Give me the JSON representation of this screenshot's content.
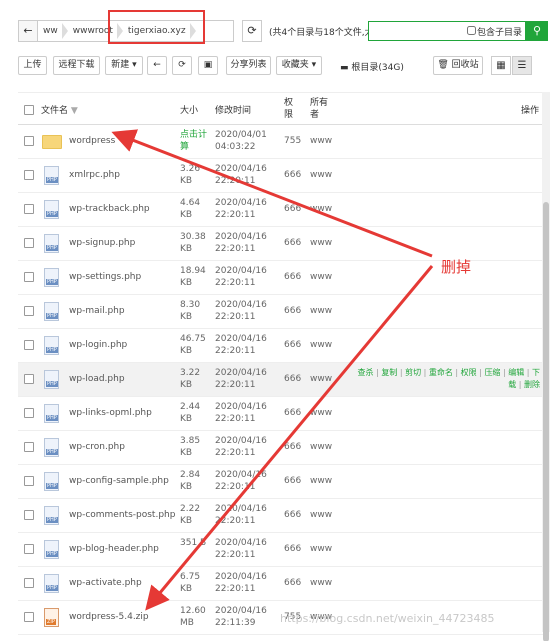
{
  "pathbar": {
    "crumbs": [
      "ww",
      "wwwroot",
      "tigerxiao.xyz"
    ],
    "summary": "(共4个目录与18个文件,大",
    "include_subdir_label": "包含子目录"
  },
  "toolbar": {
    "upload": "上传",
    "remote_download": "远程下载",
    "new": "新建",
    "share_list": "分享列表",
    "favorites": "收藏夹",
    "root_dir": "根目录(34G)",
    "recycle_bin": "回收站"
  },
  "table": {
    "headers": {
      "name": "文件名",
      "size": "大小",
      "modified": "修改时间",
      "perm": "权限",
      "owner": "所有者",
      "ops": "操作"
    },
    "rows": [
      {
        "name": "wordpress",
        "type": "folder",
        "size": "点击计算",
        "date": "2020/04/01",
        "time": "04:03:22",
        "perm": "755",
        "owner": "www"
      },
      {
        "name": "xmlrpc.php",
        "type": "php",
        "size": "3.26 KB",
        "date": "2020/04/16",
        "time": "22:20:11",
        "perm": "666",
        "owner": "www"
      },
      {
        "name": "wp-trackback.php",
        "type": "php",
        "size": "4.64 KB",
        "date": "2020/04/16",
        "time": "22:20:11",
        "perm": "666",
        "owner": "www"
      },
      {
        "name": "wp-signup.php",
        "type": "php",
        "size": "30.38 KB",
        "date": "2020/04/16",
        "time": "22:20:11",
        "perm": "666",
        "owner": "www"
      },
      {
        "name": "wp-settings.php",
        "type": "php",
        "size": "18.94 KB",
        "date": "2020/04/16",
        "time": "22:20:11",
        "perm": "666",
        "owner": "www"
      },
      {
        "name": "wp-mail.php",
        "type": "php",
        "size": "8.30 KB",
        "date": "2020/04/16",
        "time": "22:20:11",
        "perm": "666",
        "owner": "www"
      },
      {
        "name": "wp-login.php",
        "type": "php",
        "size": "46.75 KB",
        "date": "2020/04/16",
        "time": "22:20:11",
        "perm": "666",
        "owner": "www"
      },
      {
        "name": "wp-load.php",
        "type": "php",
        "size": "3.22 KB",
        "date": "2020/04/16",
        "time": "22:20:11",
        "perm": "666",
        "owner": "www"
      },
      {
        "name": "wp-links-opml.php",
        "type": "php",
        "size": "2.44 KB",
        "date": "2020/04/16",
        "time": "22:20:11",
        "perm": "666",
        "owner": "www"
      },
      {
        "name": "wp-cron.php",
        "type": "php",
        "size": "3.85 KB",
        "date": "2020/04/16",
        "time": "22:20:11",
        "perm": "666",
        "owner": "www"
      },
      {
        "name": "wp-config-sample.php",
        "type": "php",
        "size": "2.84 KB",
        "date": "2020/04/16",
        "time": "22:20:11",
        "perm": "666",
        "owner": "www"
      },
      {
        "name": "wp-comments-post.php",
        "type": "php",
        "size": "2.22 KB",
        "date": "2020/04/16",
        "time": "22:20:11",
        "perm": "666",
        "owner": "www"
      },
      {
        "name": "wp-blog-header.php",
        "type": "php",
        "size": "351 B",
        "date": "2020/04/16",
        "time": "22:20:11",
        "perm": "666",
        "owner": "www"
      },
      {
        "name": "wp-activate.php",
        "type": "php",
        "size": "6.75 KB",
        "date": "2020/04/16",
        "time": "22:20:11",
        "perm": "666",
        "owner": "www"
      },
      {
        "name": "wordpress-5.4.zip",
        "type": "zip",
        "size": "12.60 MB",
        "date": "2020/04/16",
        "time": "22:11:39",
        "perm": "755",
        "owner": "www"
      }
    ],
    "row_ops": {
      "line1": [
        "查杀",
        "复制",
        "剪切",
        "重命名",
        "权限",
        "压缩",
        "编辑",
        "下"
      ],
      "line2": [
        "载",
        "删除"
      ]
    }
  },
  "annotation": {
    "label": "删掉",
    "color": "#e53935"
  },
  "watermark": "https://blog.csdn.net/weixin_44723485",
  "colors": {
    "accent": "#20a53a",
    "folder": "#f7d67a",
    "annotation": "#e53935"
  }
}
